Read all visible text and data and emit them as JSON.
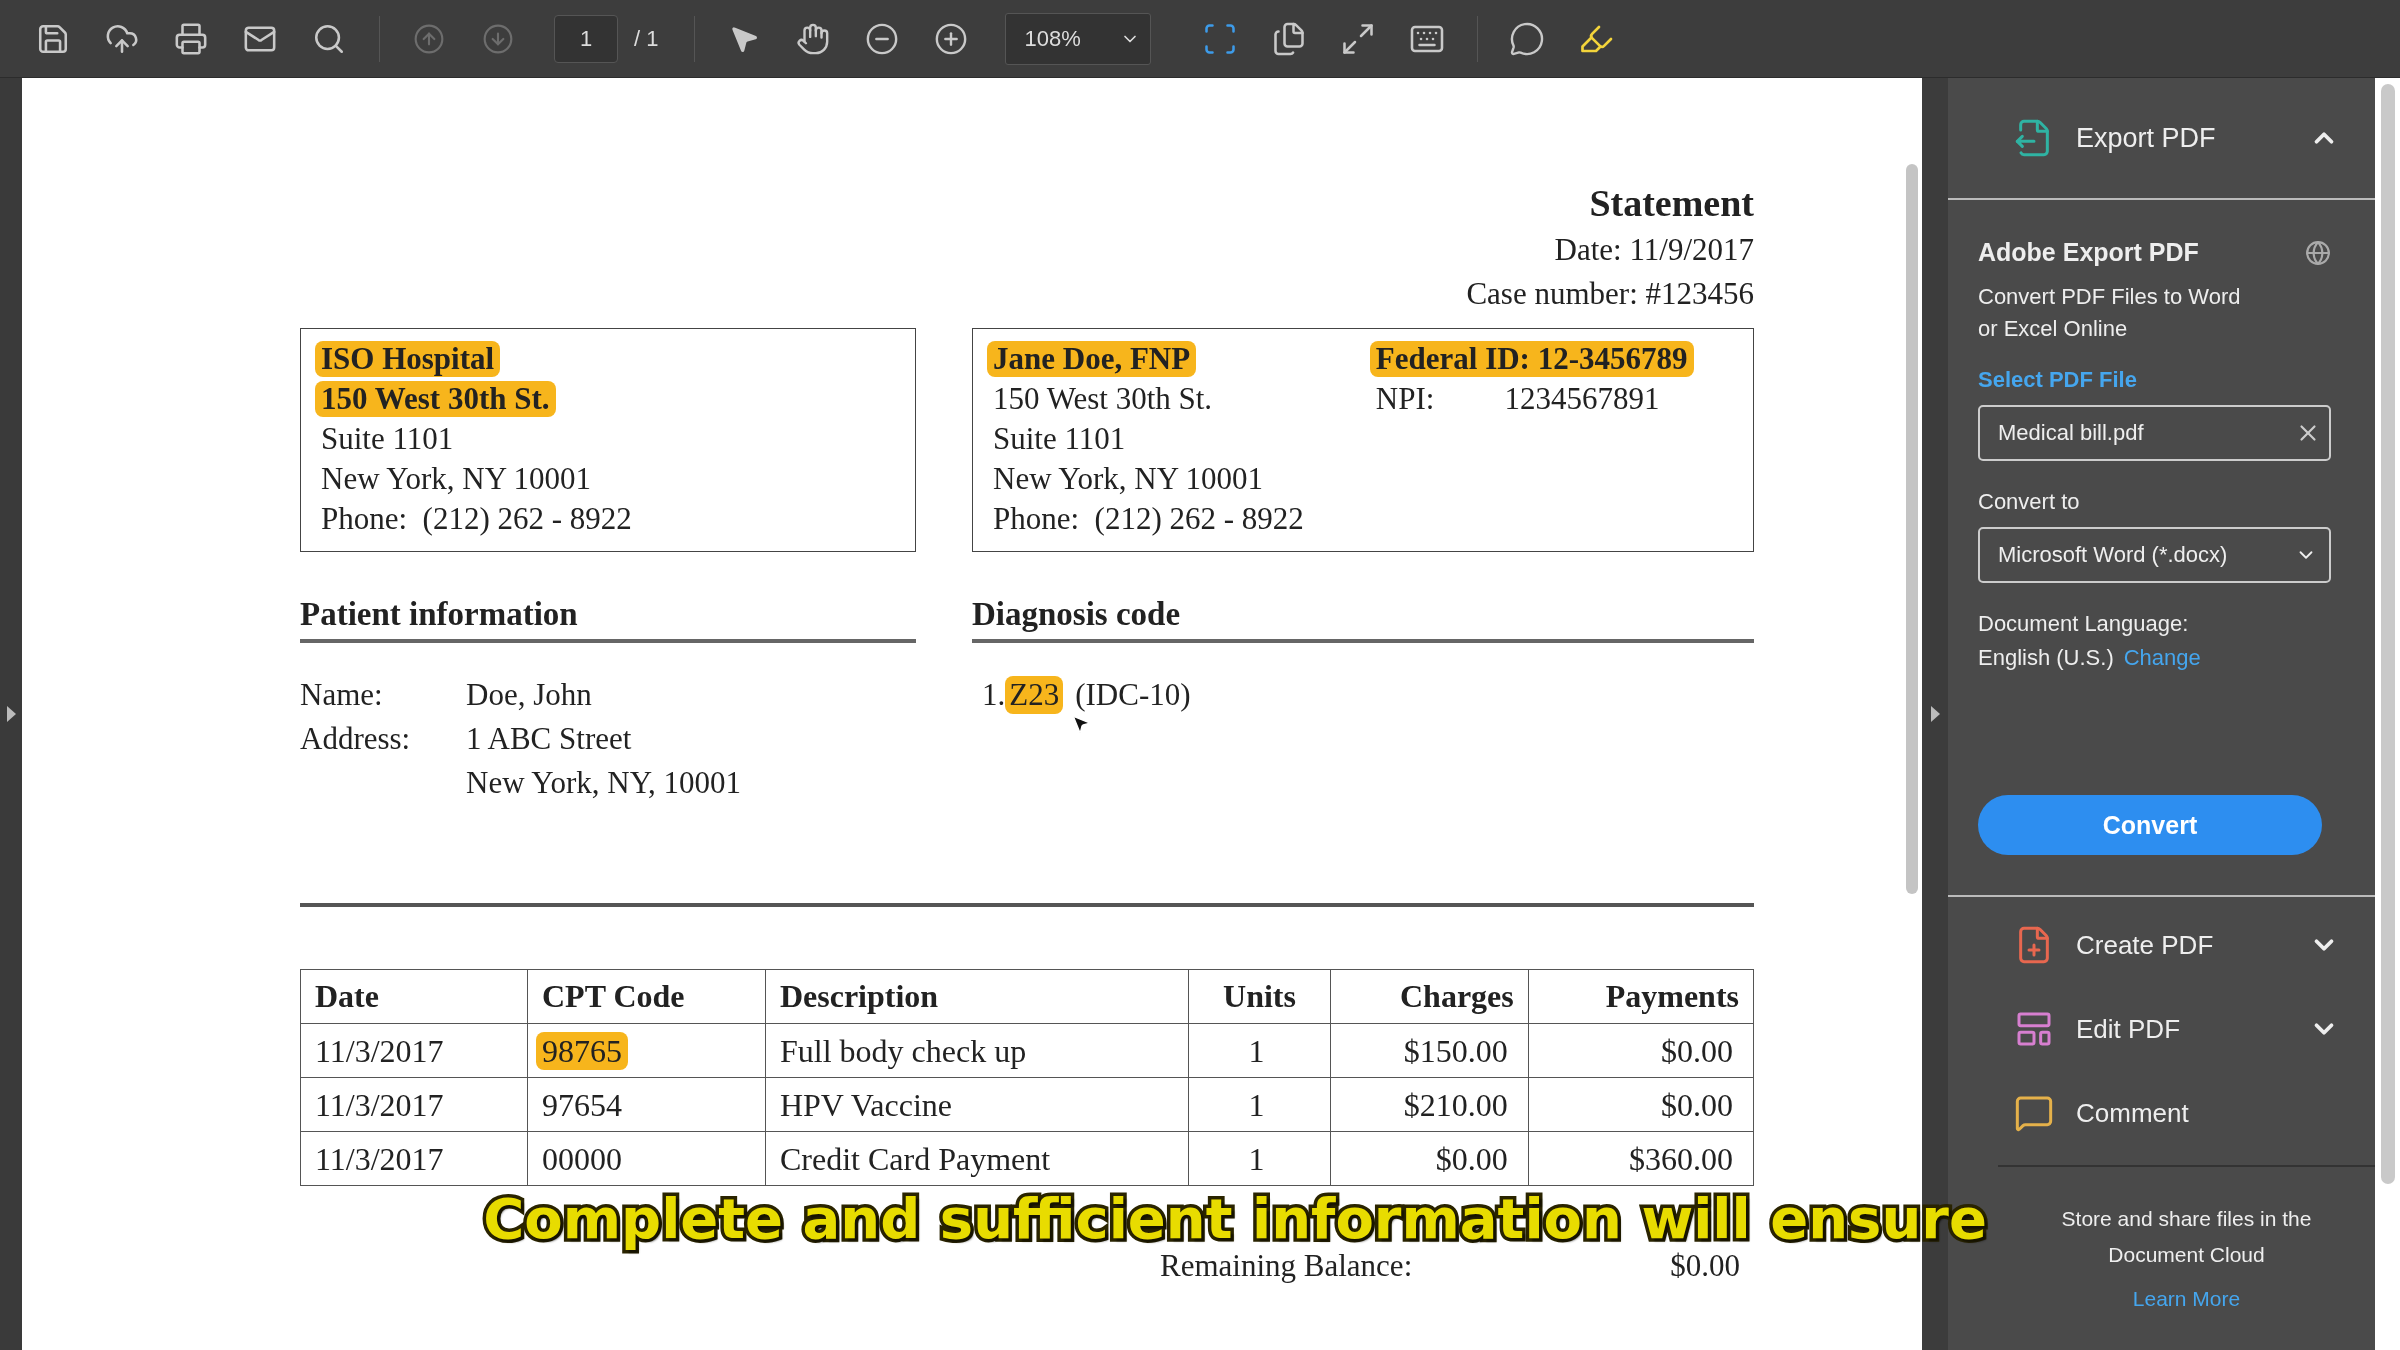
{
  "toolbar": {
    "page_nav": [
      {
        "disabled": true
      },
      {
        "disabled": true
      }
    ],
    "page_number": "1",
    "page_total": "/ 1",
    "zoom": "108%",
    "view_buttons": [
      {
        "selected": true
      },
      {
        "selected": false
      },
      {
        "selected": false
      },
      {
        "selected": false
      }
    ]
  },
  "document": {
    "title": "Statement",
    "date": "Date: 11/9/2017",
    "case_number": "Case number: #123456",
    "facility": {
      "lines": [
        {
          "text": "ISO Hospital",
          "highlighted": true
        },
        {
          "text": "150 West 30th St.",
          "highlighted": true
        },
        {
          "text": "Suite 1101",
          "highlighted": false
        },
        {
          "text": "New York, NY 10001",
          "highlighted": false
        },
        {
          "text": "Phone:  (212) 262 - 8922",
          "highlighted": false
        }
      ]
    },
    "provider": {
      "lines": [
        {
          "text": "Jane Doe, FNP",
          "highlighted": true
        },
        {
          "text": "150 West 30th St.",
          "highlighted": false
        },
        {
          "text": "Suite 1101",
          "highlighted": false
        },
        {
          "text": "New York, NY 10001",
          "highlighted": false
        },
        {
          "text": "Phone:  (212) 262 - 8922",
          "highlighted": false
        }
      ],
      "ids": [
        {
          "kind": "single",
          "text": "Federal ID: 12-3456789",
          "highlighted": true
        },
        {
          "kind": "pair",
          "label": "NPI:",
          "value": "1234567891",
          "highlighted": false
        }
      ]
    },
    "patient": {
      "heading": "Patient information",
      "rows": [
        {
          "label": "Name:",
          "value": "Doe, John"
        },
        {
          "label": "Address:",
          "value": "1 ABC Street"
        },
        {
          "value": "New York, NY, 10001"
        }
      ]
    },
    "diagnosis": {
      "heading": "Diagnosis code",
      "items": [
        {
          "number": "1.",
          "code": "Z23",
          "code_highlighted": true,
          "system": "(IDC-10)"
        }
      ]
    },
    "table": {
      "columns": [
        "Date",
        "CPT Code",
        "Description",
        "Units",
        "Charges",
        "Payments"
      ],
      "rows": [
        {
          "cells": [
            {
              "text": "11/3/2017",
              "highlighted": false
            },
            {
              "text": "98765",
              "highlighted": true
            },
            {
              "text": "Full body check up",
              "highlighted": false
            },
            {
              "text": "1",
              "highlighted": false
            },
            {
              "text": "$150.00",
              "highlighted": false
            },
            {
              "text": "$0.00",
              "highlighted": false
            }
          ]
        },
        {
          "cells": [
            {
              "text": "11/3/2017",
              "highlighted": false
            },
            {
              "text": "97654",
              "highlighted": false
            },
            {
              "text": "HPV Vaccine",
              "highlighted": false
            },
            {
              "text": "1",
              "highlighted": false
            },
            {
              "text": "$210.00",
              "highlighted": false
            },
            {
              "text": "$0.00",
              "highlighted": false
            }
          ]
        },
        {
          "cells": [
            {
              "text": "11/3/2017",
              "highlighted": false
            },
            {
              "text": "00000",
              "highlighted": false
            },
            {
              "text": "Credit Card Payment",
              "highlighted": false
            },
            {
              "text": "1",
              "highlighted": false
            },
            {
              "text": "$0.00",
              "highlighted": false
            },
            {
              "text": "$360.00",
              "highlighted": false
            }
          ]
        }
      ]
    },
    "balance": {
      "label": "Remaining Balance:",
      "value": "$0.00"
    }
  },
  "caption": "Complete and sufficient information will ensure",
  "panel": {
    "export": {
      "title": "Export PDF",
      "expanded": true,
      "service": "Adobe Export PDF",
      "description_lines": [
        "Convert PDF Files to Word",
        "or Excel Online"
      ],
      "select_label": "Select PDF File",
      "file": "Medical bill.pdf",
      "convert_label": "Convert to",
      "format": "Microsoft Word (*.docx)",
      "language_label": "Document Language:",
      "language": "English (U.S.)",
      "change_link": "Change",
      "convert_button": "Convert"
    },
    "tools": [
      {
        "kind": "create",
        "label": "Create PDF",
        "expanded": false
      },
      {
        "kind": "edit",
        "label": "Edit PDF",
        "expanded": false
      },
      {
        "kind": "comment",
        "label": "Comment"
      }
    ],
    "cloud": {
      "lines": [
        "Store and share files in the",
        "Document Cloud"
      ],
      "link": "Learn More"
    }
  }
}
